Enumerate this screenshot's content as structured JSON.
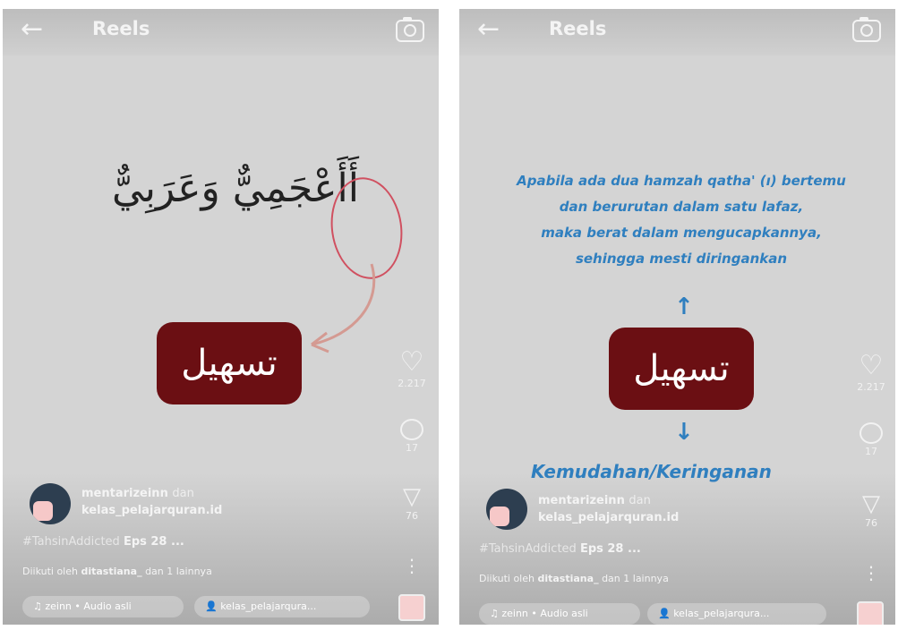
{
  "panels": [
    {
      "header": {
        "back": "←",
        "title": "Reels",
        "camera_icon": "camera-icon"
      },
      "arabic_line": "أَأَعْجَمِيٌّ وَعَرَبِيٌّ",
      "badge": "تسهيل",
      "likes": "2.217",
      "comments": "17",
      "shares": "76",
      "author": {
        "user1": "mentarizeinn",
        "dan": "dan",
        "user2": "kelas_pelajarquran.id"
      },
      "caption": {
        "tag": "#TahsinAddicted",
        "eps": "Eps 28 ..."
      },
      "followers": {
        "prefix": "Diikuti oleh",
        "who": "ditastiana_",
        "suffix": "dan 1 lainnya"
      },
      "audio": "zeinn • Audio asli",
      "account": "kelas_pelajarqura..."
    },
    {
      "header": {
        "back": "←",
        "title": "Reels",
        "camera_icon": "camera-icon"
      },
      "explanation": [
        "Apabila ada dua hamzah qatha' (ı) bertemu",
        "dan berurutan dalam satu lafaz,",
        "maka berat dalam mengucapkannya,",
        "sehingga mesti diringankan"
      ],
      "badge": "تسهيل",
      "meaning": "Kemudahan/Keringanan",
      "likes": "2.217",
      "comments": "17",
      "shares": "76",
      "author": {
        "user1": "mentarizeinn",
        "dan": "dan",
        "user2": "kelas_pelajarquran.id"
      },
      "caption": {
        "tag": "#TahsinAddicted",
        "eps": "Eps 28 ..."
      },
      "followers": {
        "prefix": "Diikuti oleh",
        "who": "ditastiana_",
        "suffix": "dan 1 lainnya"
      },
      "audio": "zeinn • Audio asli",
      "account": "kelas_pelajarqura..."
    }
  ],
  "colors": {
    "badge": "#6b0f13",
    "annotation_blue": "#2f7fbf",
    "circle": "#d05060",
    "background": "#d4d4d4"
  }
}
